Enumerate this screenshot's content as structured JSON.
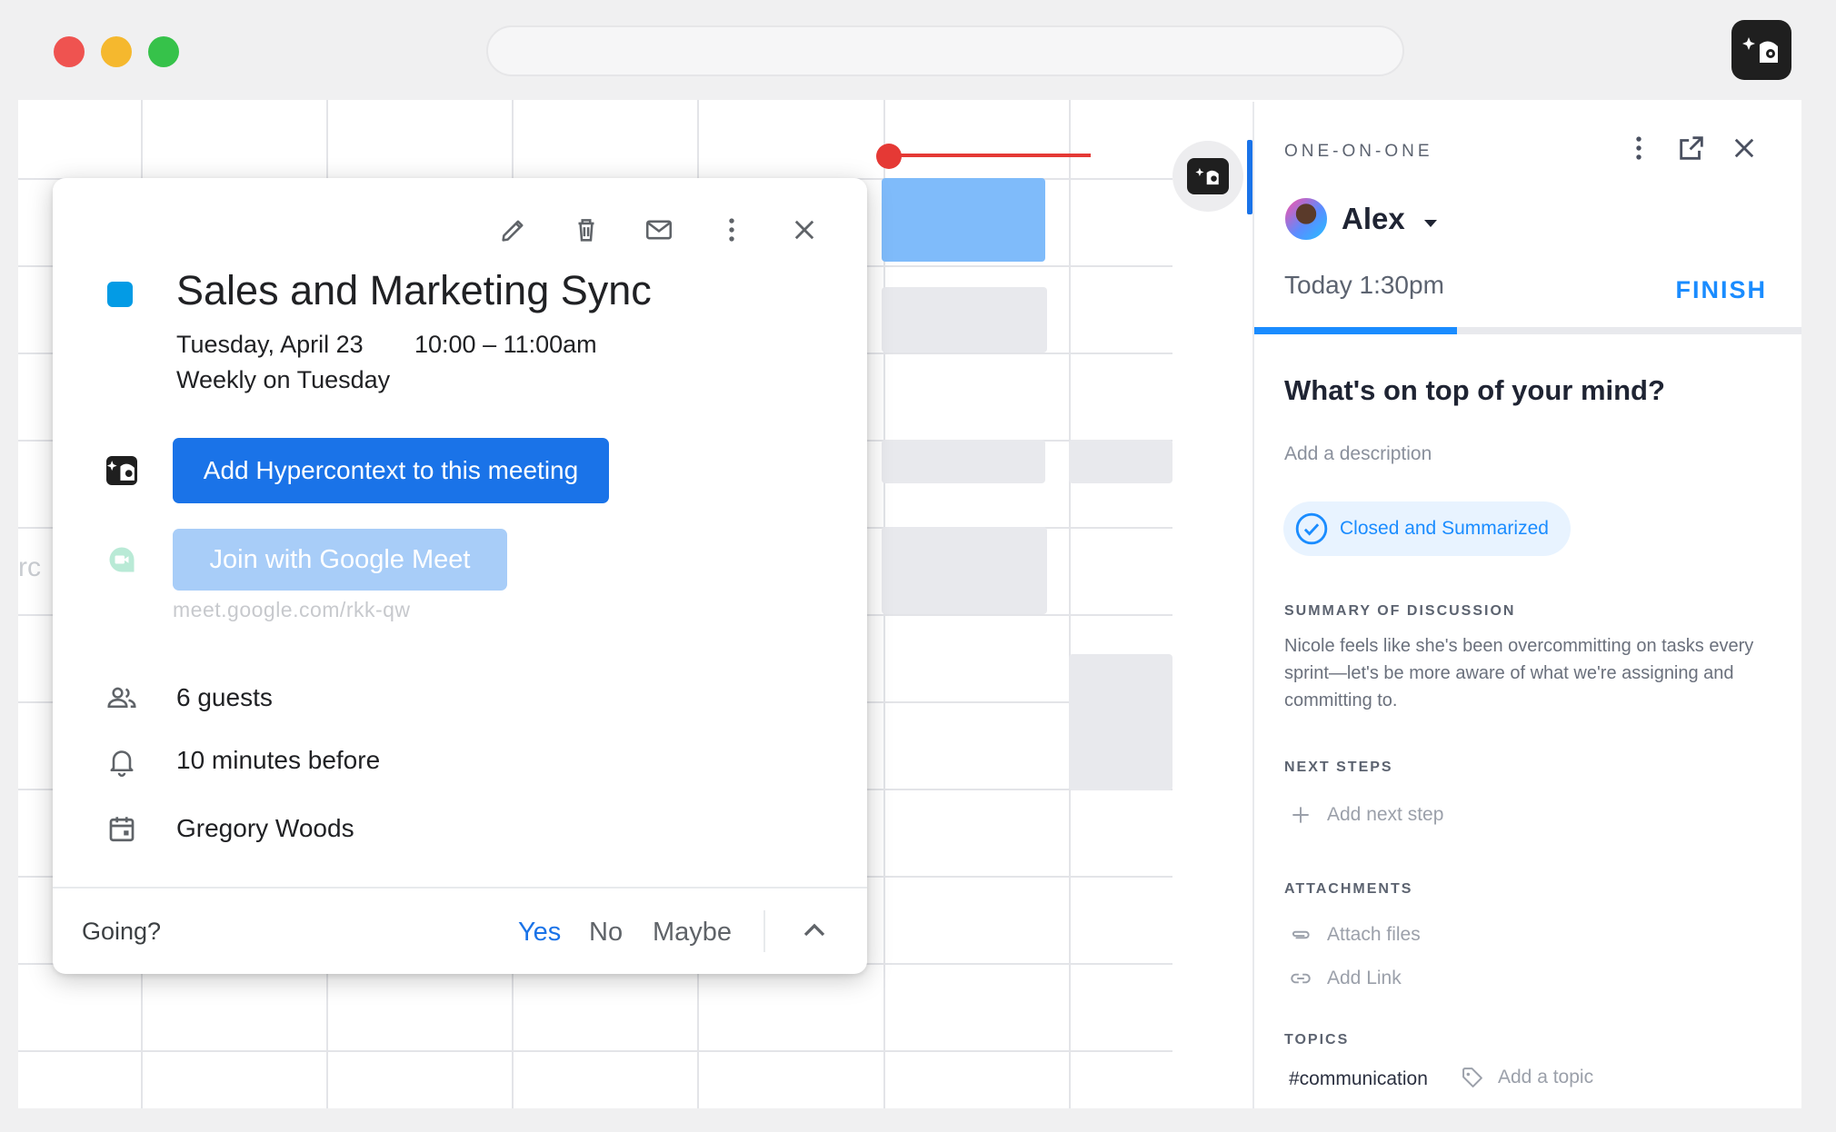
{
  "event": {
    "title": "Sales and Marketing Sync",
    "date": "Tuesday, April 23",
    "time": "10:00 – 11:00am",
    "recurrence": "Weekly on Tuesday",
    "color": "#039be5",
    "add_button": "Add Hypercontext to this meeting",
    "meet_button": "Join with Google Meet",
    "meet_link": "meet.google.com/rkk-qw",
    "guests": "6 guests",
    "reminder": "10 minutes before",
    "organizer": "Gregory Woods",
    "going_label": "Going?",
    "rsvp": {
      "yes": "Yes",
      "no": "No",
      "maybe": "Maybe"
    }
  },
  "panel": {
    "type_label": "ONE-ON-ONE",
    "person": "Alex",
    "time": "Today 1:30pm",
    "finish": "FINISH",
    "progress": 0.37,
    "question": "What's on top of your mind?",
    "description_placeholder": "Add a description",
    "status": "Closed and Summarized",
    "summary_label": "SUMMARY OF DISCUSSION",
    "summary": "Nicole feels like she's been overcommitting on tasks every sprint—let's be more aware of what we're assigning and committing to.",
    "next_steps_label": "NEXT STEPS",
    "add_next_step": "Add next step",
    "attachments_label": "ATTACHMENTS",
    "attach_files": "Attach files",
    "add_link": "Add Link",
    "topics_label": "TOPICS",
    "topic_tag": "#communication",
    "add_topic": "Add a topic"
  },
  "colors": {
    "accent": "#1a73e8",
    "finish": "#1a8cff",
    "now_line": "#e53935"
  },
  "edge_text": "rc"
}
